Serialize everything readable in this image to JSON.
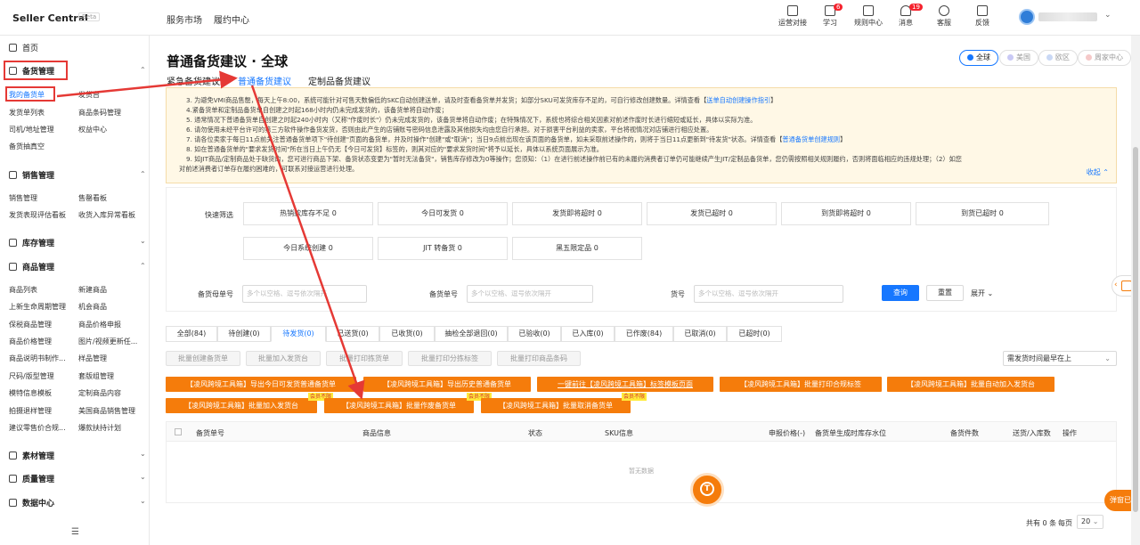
{
  "header": {
    "brand": "Seller Central",
    "brand_badge": "Beta",
    "nav": [
      "服务市场",
      "履约中心"
    ],
    "tools": [
      {
        "label": "运营对接",
        "icon": "monitor-icon",
        "badge": ""
      },
      {
        "label": "学习",
        "icon": "book-icon",
        "badge": "6"
      },
      {
        "label": "规则中心",
        "icon": "rules-icon",
        "badge": ""
      },
      {
        "label": "消息",
        "icon": "bell-icon",
        "badge": "19"
      },
      {
        "label": "客服",
        "icon": "headset-icon",
        "badge": ""
      },
      {
        "label": "反馈",
        "icon": "feedback-icon",
        "badge": ""
      }
    ]
  },
  "sidebar": {
    "home": "首页",
    "groups": {
      "stock": "备货管理",
      "sales": "销售管理",
      "inventory": "库存管理",
      "goods": "商品管理",
      "material": "素材管理",
      "quality": "质量管理",
      "data": "数据中心"
    },
    "stock_items": [
      "我的备货单",
      "发货台",
      "发货单列表",
      "商品条码管理",
      "司机/地址管理",
      "权益中心",
      "备货抽真空"
    ],
    "sales_items": [
      "销售管理",
      "售罄看板",
      "发货表现评估看板",
      "收货入库异常看板"
    ],
    "goods_items": [
      "商品列表",
      "新建商品",
      "上新生命周期管理",
      "机会商品",
      "保税商品管理",
      "商品价格申报",
      "商品价格管理",
      "图片/视频更新任...",
      "商品说明书制作...",
      "样品管理",
      "尺码/版型管理",
      "套版组管理",
      "模特信息模板",
      "定制商品内容",
      "拍摄退样管理",
      "美国商品销售管理",
      "建议零售价合规...",
      "爆款扶持计划"
    ]
  },
  "page": {
    "title": "普通备货建议 · 全球",
    "sub_tabs": [
      "紧急备货建议",
      "普通备货建议",
      "定制品备货建议"
    ],
    "regions": [
      "全球",
      "美国",
      "欧区",
      "周家中心"
    ]
  },
  "notice": {
    "lines": [
      "3. 为避免VMI商品售罄，每天上午8:00，系统可能针对可售天数偏低的SKC自动创建送单，请及时查看备货单并发货；如部分SKU可发货库存不足的，可自行修改创建数量。详情查看【",
      "4.紧备货单和定制品备货单自创建之时起168小时内仍未完成发货的，该备货单将自动作废；",
      "5. 通常情况下普通备货单自创建之时起240小时内（又称\"作废时长\"）仍未完成发货的，该备货单将自动作废；在特殊情况下，系统也将综合相关因素对前述作废时长进行缩短或延长，具体以实际为准。",
      "6. 请勿使用未经平台许可的第三方软件操作备货发货，否则由此产生的店铺账号密码信息泄露及其他损失均由您自行承担。对于损害平台利益的卖家，平台将视情况对店铺进行相应处置。",
      "7. 请各位卖家于每日11点前关注普通备货单项下\"待创建\"页面的备货单，并及时操作\"创建\"或\"取消\"；当日9点前出现在该页面的备货单，如未采取前述操作的，则将于当日11点更新到\"待发货\"状态。详情查看【",
      "8. 如在普通备货单的\"要求发货时间\"所在当日上午仍无【今日可发货】标签的，则其对应的\"要求发货时间\"将予以延长，具体以系统页面展示为准。",
      "9. 如JIT商品/定制商品处于缺货的，您可进行商品下架、备货状态变更为\"暂时无法备货\"，销售库存修改为0等操作；您须知：（1）在进行前述操作前已有的未履约消费者订单仍可能继续产生JIT/定制品备货单，您仍需按照相关规则履约，否则将面临相应的违规处理；（2）如您",
      "对前述消费者订单存在履约困难的，可联系对接运营进行处理。"
    ],
    "link_auto": "送单自动创建操作指引",
    "link_rules": "普通备货单创建规则",
    "collapse": "收起"
  },
  "filters": {
    "quick_label": "快速筛选",
    "quick": [
      {
        "label": "热销款库存不足",
        "count": "0"
      },
      {
        "label": "今日可发货",
        "count": "0"
      },
      {
        "label": "发货即将超时",
        "count": "0"
      },
      {
        "label": "发货已超时",
        "count": "0"
      },
      {
        "label": "到货即将超时",
        "count": "0"
      },
      {
        "label": "到货已超时",
        "count": "0"
      },
      {
        "label": "今日系统创建",
        "count": "0"
      },
      {
        "label": "JIT 转备货",
        "count": "0"
      },
      {
        "label": "黑五限定品",
        "count": "0"
      }
    ],
    "fields": [
      {
        "label": "备货母单号",
        "placeholder": "多个以空格、逗号依次隔开"
      },
      {
        "label": "备货单号",
        "placeholder": "多个以空格、逗号依次隔开"
      },
      {
        "label": "货号",
        "placeholder": "多个以空格、逗号依次隔开"
      }
    ],
    "query": "查询",
    "reset": "重置",
    "expand": "展开"
  },
  "status_tabs": [
    "全部(84)",
    "待创建(0)",
    "待发货(0)",
    "已送货(0)",
    "已收货(0)",
    "抽检全部退回(0)",
    "已验收(0)",
    "已入库(0)",
    "已作废(84)",
    "已取消(0)",
    "已超时(0)"
  ],
  "batch_buttons": [
    "批量创建备货单",
    "批量加入发货台",
    "批量打印拣货单",
    "批量打印分拣标签",
    "批量打印商品条码"
  ],
  "sort": "需发货时间最早在上",
  "tool_buttons": [
    "【凌风跨境工具箱】导出今日可发货普通备货单",
    "【凌风跨境工具箱】导出历史普通备货单",
    "一键前往【凌风跨境工具箱】标签模板页面",
    "【凌风跨境工具箱】批量打印合规标签",
    "【凌风跨境工具箱】批量自动加入发货台",
    "【凌风跨境工具箱】批量加入发货台",
    "【凌风跨境工具箱】批量作废备货单",
    "【凌风跨境工具箱】批量取消备货单"
  ],
  "fast_tag": "会员不限",
  "table": {
    "columns": [
      "备货单号",
      "商品信息",
      "状态",
      "SKU信息",
      "申报价格(-)",
      "备货单生成时库存水位",
      "备货件数",
      "送货/入库数",
      "操作"
    ],
    "empty": "暂无数据"
  },
  "pagination": {
    "total": "共有 0 条",
    "per_page_label": "每页",
    "per_page": "20"
  },
  "popup": "弹窗已禁",
  "colors": {
    "accent": "#1677ff",
    "orange": "#f57c0b",
    "annotation": "#e53935"
  }
}
